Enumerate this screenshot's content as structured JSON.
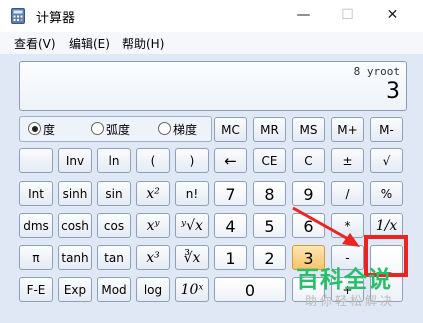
{
  "window": {
    "title": "计算器",
    "controls": {
      "minimize": "—",
      "maximize": "☐",
      "close": "✕"
    }
  },
  "menu": [
    "查看(V)",
    "编辑(E)",
    "帮助(H)"
  ],
  "display": {
    "expression": "8 yroot",
    "result": "3"
  },
  "angle_mode": {
    "options": [
      "度",
      "弧度",
      "梯度"
    ],
    "selected": "度"
  },
  "memory_buttons": [
    "MC",
    "MR",
    "MS",
    "M+",
    "M-"
  ],
  "sci_rows": [
    [
      "",
      "Inv",
      "ln",
      "(",
      ")"
    ],
    [
      "Int",
      "sinh",
      "sin",
      "x²",
      "n!"
    ],
    [
      "dms",
      "cosh",
      "cos",
      "xʸ",
      "ʸ√x"
    ],
    [
      "π",
      "tanh",
      "tan",
      "x³",
      "∛x"
    ],
    [
      "F-E",
      "Exp",
      "Mod",
      "log",
      "10ˣ"
    ]
  ],
  "std_rows": [
    [
      "←",
      "CE",
      "C",
      "±",
      "√"
    ],
    [
      "7",
      "8",
      "9",
      "/",
      "%"
    ],
    [
      "4",
      "5",
      "6",
      "*",
      "1/x"
    ],
    [
      "1",
      "2",
      "3",
      "-",
      "="
    ],
    [
      "0",
      "",
      "",
      "+",
      ""
    ]
  ],
  "watermark": {
    "brand": "百科全说",
    "tagline": "助你轻松解决"
  },
  "colors": {
    "accent_red": "#ef2222",
    "watermark_green": "#27c06a"
  }
}
